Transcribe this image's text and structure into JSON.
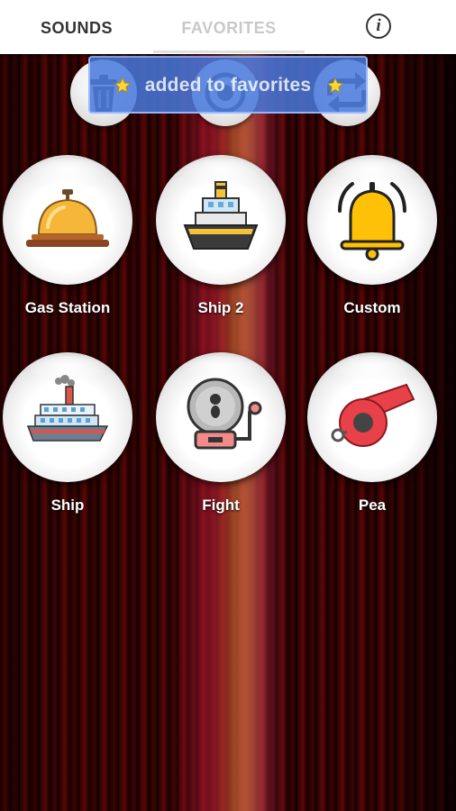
{
  "tabs": [
    {
      "label": "SOUNDS",
      "active": false
    },
    {
      "label": "FAVORITES",
      "active": true
    }
  ],
  "info_icon": "info-icon",
  "toast": {
    "text": "added to favorites",
    "icon": "star-icon"
  },
  "toolbar_icons": [
    "trash-icon",
    "stop-icon",
    "repeat-icon"
  ],
  "sounds": [
    {
      "label": "Gas Station",
      "icon": "service-bell-icon"
    },
    {
      "label": "Ship 2",
      "icon": "ship-icon"
    },
    {
      "label": "Custom",
      "icon": "bell-icon"
    },
    {
      "label": "Ship",
      "icon": "cruise-ship-icon"
    },
    {
      "label": "Fight",
      "icon": "alarm-bell-icon"
    },
    {
      "label": "Pea",
      "icon": "whistle-icon"
    }
  ],
  "colors": {
    "accent": "#c9c9c9",
    "toast": "#4678dc",
    "background": "#3a0303"
  }
}
